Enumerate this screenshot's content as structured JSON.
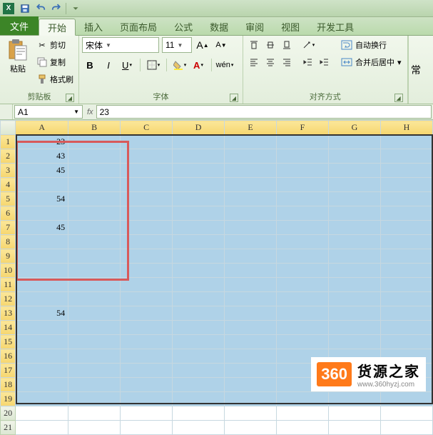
{
  "qat": {
    "app_letter": "X"
  },
  "tabs": {
    "file": "文件",
    "items": [
      "开始",
      "插入",
      "页面布局",
      "公式",
      "数据",
      "审阅",
      "视图",
      "开发工具"
    ],
    "active_index": 0
  },
  "ribbon": {
    "clipboard": {
      "paste": "粘贴",
      "cut": "剪切",
      "copy": "复制",
      "format_painter": "格式刷",
      "label": "剪贴板"
    },
    "font": {
      "name": "宋体",
      "size": "11",
      "label": "字体",
      "bold": "B",
      "italic": "I",
      "underline": "U"
    },
    "alignment": {
      "wrap": "自动换行",
      "merge": "合并后居中",
      "label": "对齐方式"
    }
  },
  "formula_bar": {
    "name_box": "A1",
    "fx": "fx",
    "value": "23"
  },
  "columns": [
    "A",
    "B",
    "C",
    "D",
    "E",
    "F",
    "G",
    "H"
  ],
  "rows_total": 21,
  "selected_row_headers": 19,
  "cells": {
    "A1": "23",
    "A2": "43",
    "A3": "45",
    "A5": "54",
    "A7": "45",
    "A13": "54"
  },
  "chart_data": {
    "type": "table",
    "title": "",
    "columns": [
      "A"
    ],
    "rows": [
      {
        "row": 1,
        "A": 23
      },
      {
        "row": 2,
        "A": 43
      },
      {
        "row": 3,
        "A": 45
      },
      {
        "row": 4,
        "A": null
      },
      {
        "row": 5,
        "A": 54
      },
      {
        "row": 6,
        "A": null
      },
      {
        "row": 7,
        "A": 45
      },
      {
        "row": 8,
        "A": null
      },
      {
        "row": 9,
        "A": null
      },
      {
        "row": 10,
        "A": null
      },
      {
        "row": 11,
        "A": null
      },
      {
        "row": 12,
        "A": null
      },
      {
        "row": 13,
        "A": 54
      }
    ]
  },
  "watermark": {
    "badge": "360",
    "main": "货源之家",
    "sub": "www.360hyzj.com"
  }
}
